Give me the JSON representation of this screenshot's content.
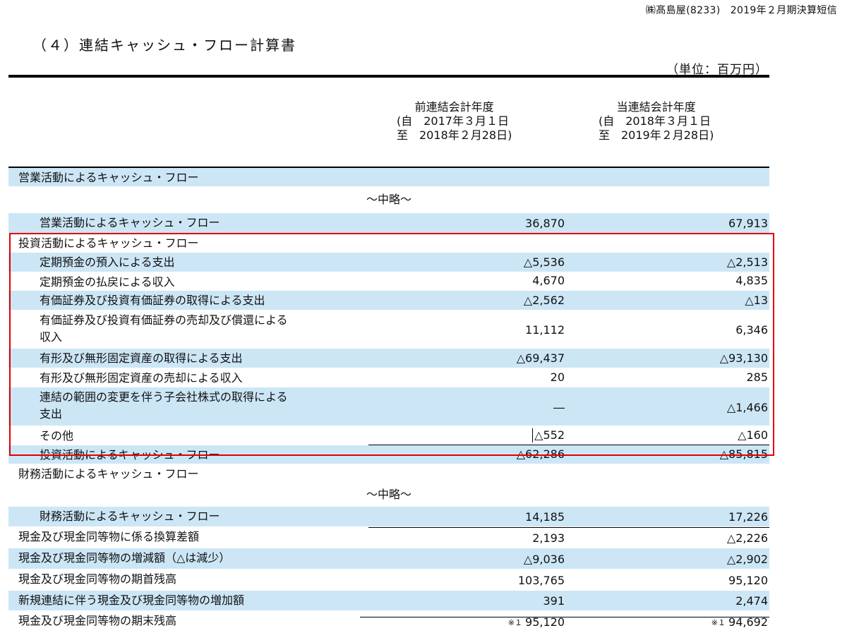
{
  "header": {
    "company_line": "㈱髙島屋(8233)　2019年２月期決算短信"
  },
  "title": "（４）連結キャッシュ・フロー計算書",
  "unit": "（単位：百万円）",
  "columns": {
    "prev": {
      "line1": "前連結会計年度",
      "line2": "(自　2017年３月１日",
      "line3": "至　2018年２月28日)"
    },
    "curr": {
      "line1": "当連結会計年度",
      "line2": "(自　2018年３月１日",
      "line3": "至　2019年２月28日)"
    }
  },
  "rows": [
    {
      "label": "営業活動によるキャッシュ・フロー",
      "prev": "",
      "curr": ""
    },
    {
      "label": "～中略～",
      "prev": "",
      "curr": ""
    },
    {
      "label": "営業活動によるキャッシュ・フロー",
      "prev": "36,870",
      "curr": "67,913"
    },
    {
      "label": "投資活動によるキャッシュ・フロー",
      "prev": "",
      "curr": ""
    },
    {
      "label": "定期預金の預入による支出",
      "prev": "△5,536",
      "curr": "△2,513"
    },
    {
      "label": "定期預金の払戻による収入",
      "prev": "4,670",
      "curr": "4,835"
    },
    {
      "label": "有価証券及び投資有価証券の取得による支出",
      "prev": "△2,562",
      "curr": "△13"
    },
    {
      "label": "有価証券及び投資有価証券の売却及び償還による\n収入",
      "prev": "11,112",
      "curr": "6,346"
    },
    {
      "label": "有形及び無形固定資産の取得による支出",
      "prev": "△69,437",
      "curr": "△93,130"
    },
    {
      "label": "有形及び無形固定資産の売却による収入",
      "prev": "20",
      "curr": "285"
    },
    {
      "label": "連結の範囲の変更を伴う子会社株式の取得による\n支出",
      "prev": "―",
      "curr": "△1,466"
    },
    {
      "label": "その他",
      "prev": "△552",
      "curr": "△160"
    },
    {
      "label": "投資活動によるキャッシュ・フロー",
      "prev": "△62,286",
      "curr": "△85,815"
    },
    {
      "label": "財務活動によるキャッシュ・フロー",
      "prev": "",
      "curr": ""
    },
    {
      "label": "～中略～",
      "prev": "",
      "curr": ""
    },
    {
      "label": "財務活動によるキャッシュ・フロー",
      "prev": "14,185",
      "curr": "17,226"
    },
    {
      "label": "現金及び現金同等物に係る換算差額",
      "prev": "2,193",
      "curr": "△2,226"
    },
    {
      "label": "現金及び現金同等物の増減額（△は減少）",
      "prev": "△9,036",
      "curr": "△2,902"
    },
    {
      "label": "現金及び現金同等物の期首残高",
      "prev": "103,765",
      "curr": "95,120"
    },
    {
      "label": "新規連結に伴う現金及び現金同等物の増加額",
      "prev": "391",
      "curr": "2,474"
    },
    {
      "label": "現金及び現金同等物の期末残高",
      "prev": "95,120",
      "curr": "94,692",
      "note": "※１"
    }
  ]
}
